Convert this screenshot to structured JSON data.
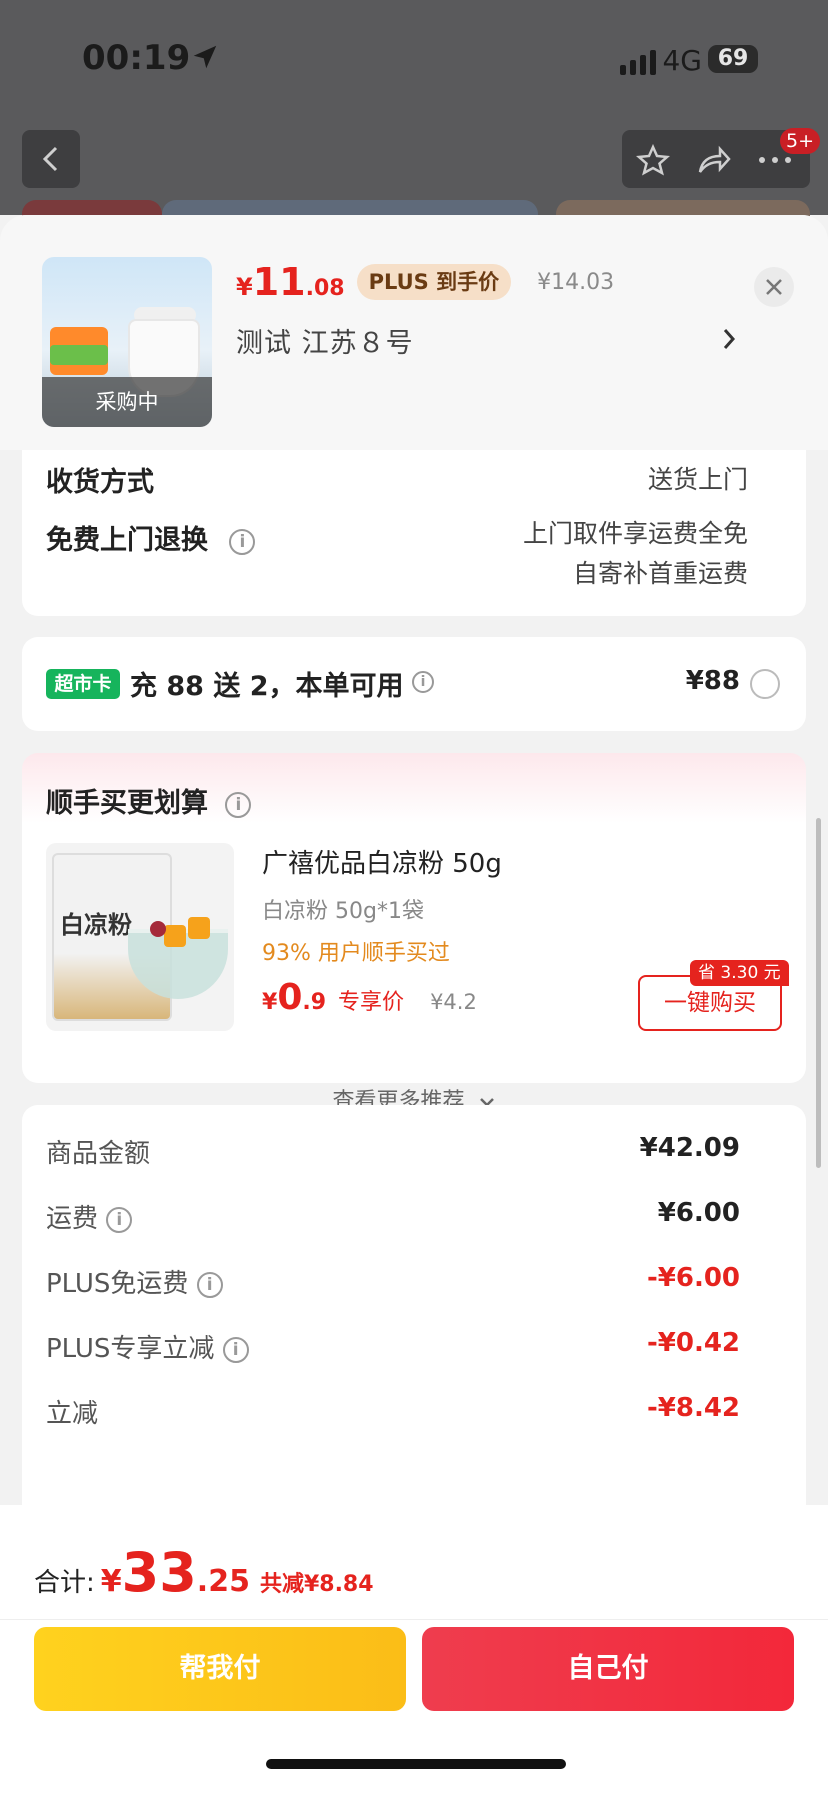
{
  "status_bar": {
    "time": "00:19",
    "network": "4G",
    "battery": "69"
  },
  "nav": {
    "badge": "5+"
  },
  "product": {
    "price_yen": "¥",
    "price_int": "11",
    "price_dec": ".08",
    "plus_tag": "PLUS 到手价",
    "original_price": "¥14.03",
    "address": "测试  江苏８号",
    "thumb_status": "采购中"
  },
  "delivery": {
    "method_label": "收货方式",
    "method_value": "送货上门",
    "return_label": "免费上门退换",
    "return_value_1": "上门取件享运费全免",
    "return_value_2": "自寄补首重运费"
  },
  "market_card": {
    "chip": "超市卡",
    "text": "充 88 送 2，本单可用",
    "amount": "¥88"
  },
  "addon": {
    "title": "顺手买更划算",
    "item_title": "广禧优品白凉粉 50g",
    "item_spec": "白凉粉 50g*1袋",
    "item_stat": "93% 用户顺手买过",
    "pack_text": "白凉粉",
    "price_yen": "¥",
    "price_int": "0",
    "price_dec": ".9",
    "price_label": "专享价",
    "old_price": "¥4.2",
    "save_tag": "省 3.30 元",
    "buy_button": "一键购买",
    "more": "查看更多推荐"
  },
  "summary": [
    {
      "label": "商品金额",
      "value": "¥42.09",
      "info": false,
      "red": false
    },
    {
      "label": "运费",
      "value": "¥6.00",
      "info": true,
      "red": false
    },
    {
      "label": "PLUS免运费",
      "value": "-¥6.00",
      "info": true,
      "red": true
    },
    {
      "label": "PLUS专享立减",
      "value": "-¥0.42",
      "info": true,
      "red": true
    },
    {
      "label": "立减",
      "value": "-¥8.42",
      "info": false,
      "red": true
    }
  ],
  "footer": {
    "total_label": "合计:",
    "total_yen": "¥",
    "total_int": "33",
    "total_dec": ".25",
    "saved": "共减¥8.84",
    "help_pay": "帮我付",
    "self_pay": "自己付"
  },
  "colors": {
    "accent_red": "#e5231e",
    "chip_green": "#16b45c",
    "help_yellow": "#fbbd17"
  }
}
